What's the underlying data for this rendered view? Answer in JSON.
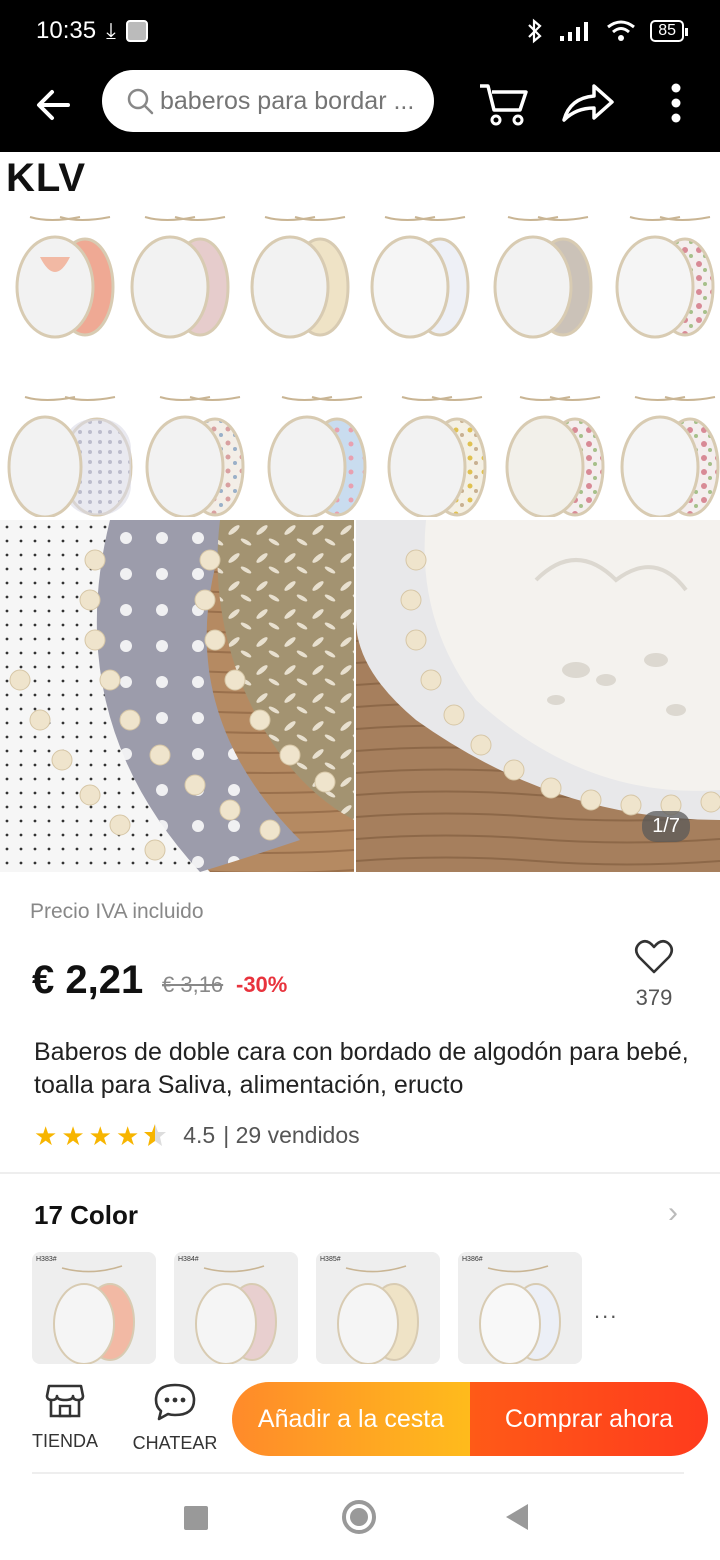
{
  "status_bar": {
    "time": "10:35",
    "battery": "85"
  },
  "header": {
    "search_placeholder": "baberos para bordar ..."
  },
  "gallery": {
    "brand": "KLV",
    "counter": "1/7"
  },
  "product": {
    "iva_note": "Precio IVA incluido",
    "price": "€ 2,21",
    "old_price": "€ 3,16",
    "discount": "-30%",
    "favorites": "379",
    "title": "Baberos de doble cara con bordado de algodón para bebé, toalla para Saliva, alimentación, eructo",
    "rating": "4.5",
    "sold": "| 29 vendidos"
  },
  "colors": {
    "title": "17 Color",
    "swatches": [
      {
        "code": "H383#",
        "accent": "#f2b9a4"
      },
      {
        "code": "H384#",
        "accent": "#e8cfcf"
      },
      {
        "code": "H385#",
        "accent": "#efe3c6"
      },
      {
        "code": "H386#",
        "accent": "#eceff6"
      }
    ],
    "more": "..."
  },
  "bottom_bar": {
    "store_label": "TIENDA",
    "chat_label": "CHATEAR",
    "add_to_cart": "Añadir a la cesta",
    "buy_now": "Comprar ahora"
  },
  "colors_theme": {
    "accent_orange": "#ff8a2a",
    "accent_red": "#ff3b1d",
    "discount_red": "#e8333d",
    "star_yellow": "#f7b500"
  }
}
